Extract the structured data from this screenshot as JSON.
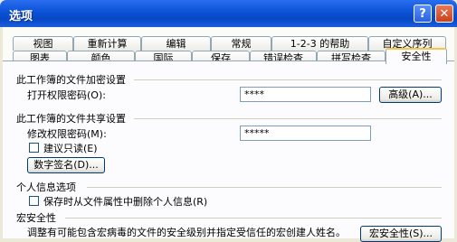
{
  "window": {
    "title": "选项",
    "help_glyph": "?",
    "close_glyph": "✕"
  },
  "tabs_row1": [
    "视图",
    "重新计算",
    "编辑",
    "常规",
    "1-2-3 的帮助",
    "自定义序列"
  ],
  "tabs_row2": [
    "图表",
    "颜色",
    "国际",
    "保存",
    "错误检查",
    "拼写检查",
    "安全性"
  ],
  "active_tab": "安全性",
  "encrypt": {
    "heading": "此工作簿的文件加密设置",
    "open_pwd_label": "打开权限密码(O):",
    "open_pwd_value": "****",
    "advanced_button": "高级(A)..."
  },
  "share": {
    "heading": "此工作簿的文件共享设置",
    "modify_pwd_label": "修改权限密码(M):",
    "modify_pwd_value": "*****",
    "readonly_label": "建议只读(E)",
    "signature_button": "数字签名(D)..."
  },
  "privacy": {
    "heading": "个人信息选项",
    "remove_info_label": "保存时从文件属性中删除个人信息(R)"
  },
  "macro": {
    "heading": "宏安全性",
    "description": "调整有可能包含宏病毒的文件的安全级别并指定受信任的宏创建人姓名。",
    "button": "宏安全性(S)..."
  }
}
